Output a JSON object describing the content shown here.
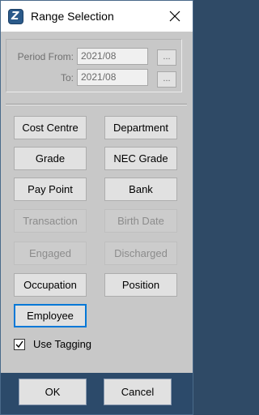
{
  "window": {
    "title": "Range Selection",
    "app_icon": "app-logo-icon",
    "app_icon_glyph": "Z",
    "close_icon": "close-icon"
  },
  "period": {
    "from_label": "Period From:",
    "from_value": "2021/08",
    "to_label": "To:",
    "to_value": "2021/08",
    "browse_label": "..."
  },
  "buttons": {
    "cost_centre": "Cost Centre",
    "department": "Department",
    "grade": "Grade",
    "nec_grade": "NEC Grade",
    "pay_point": "Pay Point",
    "bank": "Bank",
    "transaction": "Transaction",
    "birth_date": "Birth Date",
    "engaged": "Engaged",
    "discharged": "Discharged",
    "occupation": "Occupation",
    "position": "Position",
    "employee": "Employee"
  },
  "use_tagging": {
    "label": "Use Tagging",
    "checked": true
  },
  "footer": {
    "ok": "OK",
    "cancel": "Cancel"
  },
  "colors": {
    "footer_bg": "#2c4a6a",
    "focus_border": "#0078d7",
    "body_bg": "#c8c8c8"
  }
}
